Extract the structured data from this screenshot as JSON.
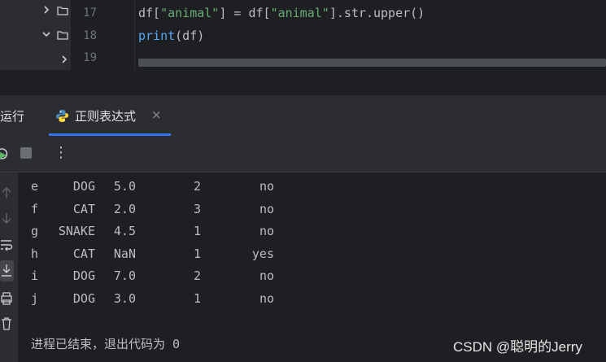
{
  "editor": {
    "lines": [
      {
        "num": "17",
        "tokens": [
          {
            "text": "df[",
            "kind": "plain"
          },
          {
            "text": "\"animal\"",
            "kind": "str"
          },
          {
            "text": "] = df[",
            "kind": "plain"
          },
          {
            "text": "\"animal\"",
            "kind": "str"
          },
          {
            "text": "].str.upper()",
            "kind": "plain"
          }
        ]
      },
      {
        "num": "18",
        "tokens": [
          {
            "text": "print",
            "kind": "fn"
          },
          {
            "text": "(df)",
            "kind": "plain"
          }
        ]
      },
      {
        "num": "19",
        "tokens": []
      }
    ]
  },
  "run": {
    "title": "运行",
    "tab_label": "正则表达式",
    "tab_close": "×",
    "more_glyph": "⋮"
  },
  "console": {
    "rows": [
      [
        "e",
        "DOG",
        "5.0",
        "2",
        "no"
      ],
      [
        "f",
        "CAT",
        "2.0",
        "3",
        "no"
      ],
      [
        "g",
        "SNAKE",
        "4.5",
        "1",
        "no"
      ],
      [
        "h",
        "CAT",
        "NaN",
        "1",
        "yes"
      ],
      [
        "i",
        "DOG",
        "7.0",
        "2",
        "no"
      ],
      [
        "j",
        "DOG",
        "3.0",
        "1",
        "no"
      ]
    ],
    "exit_message": "进程已结束，退出代码为 0"
  },
  "icons": {
    "tree": [
      "chevron-right-icon",
      "folder-icon",
      "chevron-down-icon"
    ],
    "python": "python-icon",
    "rerun": "rerun-icon",
    "stop": "stop-icon",
    "sidebar": [
      "arrow-up-icon",
      "arrow-down-icon",
      "soft-wrap-icon",
      "scroll-to-end-icon",
      "print-icon",
      "trash-icon"
    ]
  },
  "colors": {
    "accent": "#3574f0",
    "string": "#6aab73",
    "function": "#56a8f5",
    "background": "#1e1f22",
    "panel": "#2b2d30"
  },
  "watermark": "CSDN @聪明的Jerry"
}
